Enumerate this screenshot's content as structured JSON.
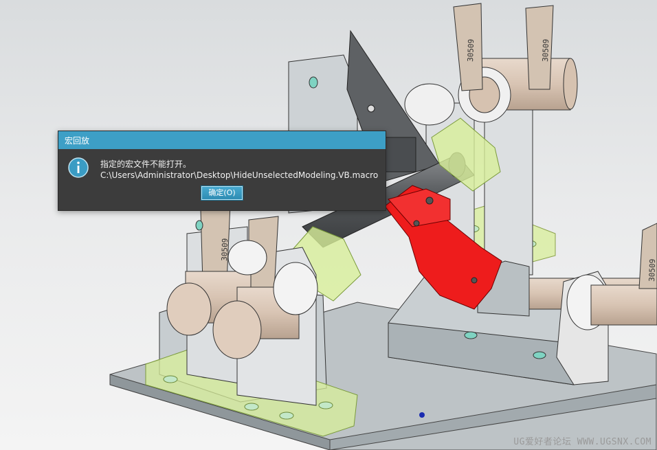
{
  "dialog": {
    "title": "宏回放",
    "message_line1": "指定的宏文件不能打开。",
    "message_line2": "C:\\Users\\Administrator\\Desktop\\HideUnselectedModeling.VB.macro",
    "ok_label": "确定(O)",
    "icon": "info-icon"
  },
  "watermark": "UG爱好者论坛 WWW.UGSNX.COM",
  "part_labels": [
    "30509",
    "30509",
    "30509",
    "30509"
  ],
  "colors": {
    "titlebar": "#3d9fc6",
    "dialog_bg": "#3c3c3c",
    "highlight_part": "#ee1c1c",
    "transparent_part": "#d8ef9a"
  }
}
